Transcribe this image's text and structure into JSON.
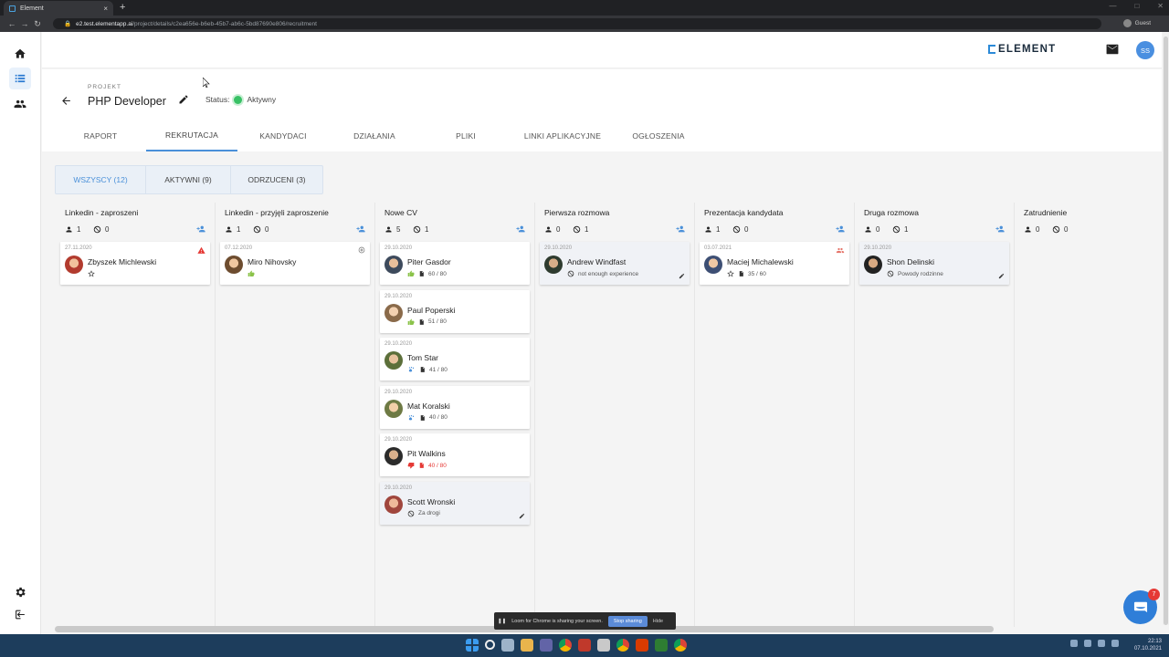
{
  "browser": {
    "tab_title": "Element",
    "tab_close": "×",
    "new_tab": "+",
    "url_host": "e2.test.elementapp.ai",
    "url_path": "/project/details/c2ea656e-b6eb-45b7-ab6c-5bd87690e806/recruitment",
    "profile": "Guest"
  },
  "app": {
    "logo": "ELEMENT",
    "user_initials": "SS"
  },
  "project": {
    "label": "PROJEKT",
    "title": "PHP Developer",
    "status_label": "Status:",
    "status_value": "Aktywny"
  },
  "tabs": [
    {
      "label": "RAPORT"
    },
    {
      "label": "REKRUTACJA"
    },
    {
      "label": "KANDYDACI"
    },
    {
      "label": "DZIAŁANIA"
    },
    {
      "label": "PLIKI"
    },
    {
      "label": "LINKI APLIKACYJNE"
    },
    {
      "label": "OGŁOSZENIA"
    }
  ],
  "active_tab": "REKRUTACJA",
  "filters": [
    {
      "label": "WSZYSCY (12)"
    },
    {
      "label": "AKTYWNI (9)"
    },
    {
      "label": "ODRZUCENI (3)"
    }
  ],
  "active_filter": "WSZYSCY (12)",
  "columns": [
    {
      "title": "Linkedin - zaproszeni",
      "active": "1",
      "rejected": "0",
      "cards": [
        {
          "date": "27.11.2020",
          "name": "Zbyszek Michlewski",
          "flag": "warning-icon",
          "meta": "star-icon"
        }
      ]
    },
    {
      "title": "Linkedin - przyjęli zaproszenie",
      "active": "1",
      "rejected": "0",
      "cards": [
        {
          "date": "07.12.2020",
          "name": "Miro Nihovsky",
          "flag": "at-icon",
          "meta": "thumb-up-icon"
        }
      ]
    },
    {
      "title": "Nowe CV",
      "active": "5",
      "rejected": "1",
      "cards": [
        {
          "date": "29.10.2020",
          "name": "Piter Gasdor",
          "score": "60 / 80"
        },
        {
          "date": "29.10.2020",
          "name": "Paul Poperski",
          "score": "51 / 80"
        },
        {
          "date": "29.10.2020",
          "name": "Tom Star",
          "score": "41 / 80"
        },
        {
          "date": "29.10.2020",
          "name": "Mat Koralski",
          "score": "40 / 80"
        },
        {
          "date": "29.10.2020",
          "name": "Pit Walkins",
          "score": "40 / 80"
        },
        {
          "date": "29.10.2020",
          "name": "Scott Wronski",
          "reason": "Za drogi"
        }
      ]
    },
    {
      "title": "Pierwsza rozmowa",
      "active": "0",
      "rejected": "1",
      "cards": [
        {
          "date": "29.10.2020",
          "name": "Andrew Windfast",
          "reason": "not enough experience"
        }
      ]
    },
    {
      "title": "Prezentacja kandydata",
      "active": "1",
      "rejected": "0",
      "cards": [
        {
          "date": "03.07.2021",
          "name": "Maciej Michalewski",
          "score": "35 / 60"
        }
      ]
    },
    {
      "title": "Druga rozmowa",
      "active": "0",
      "rejected": "1",
      "cards": [
        {
          "date": "29.10.2020",
          "name": "Shon Delinski",
          "reason": "Powody rodzinne"
        }
      ]
    },
    {
      "title": "Zatrudnienie",
      "active": "0",
      "rejected": "0",
      "cards": []
    }
  ],
  "screen_share": {
    "message": "Loom for Chrome is sharing your screen.",
    "stop": "Stop sharing",
    "hide": "Hide"
  },
  "chat_badge": "7",
  "taskbar": {
    "time": "22:13",
    "date": "07.10.2021"
  },
  "colors": {
    "accent": "#4a90d9",
    "active_status": "#38c165",
    "danger": "#e53935",
    "score_ok": "#8bc34a"
  }
}
